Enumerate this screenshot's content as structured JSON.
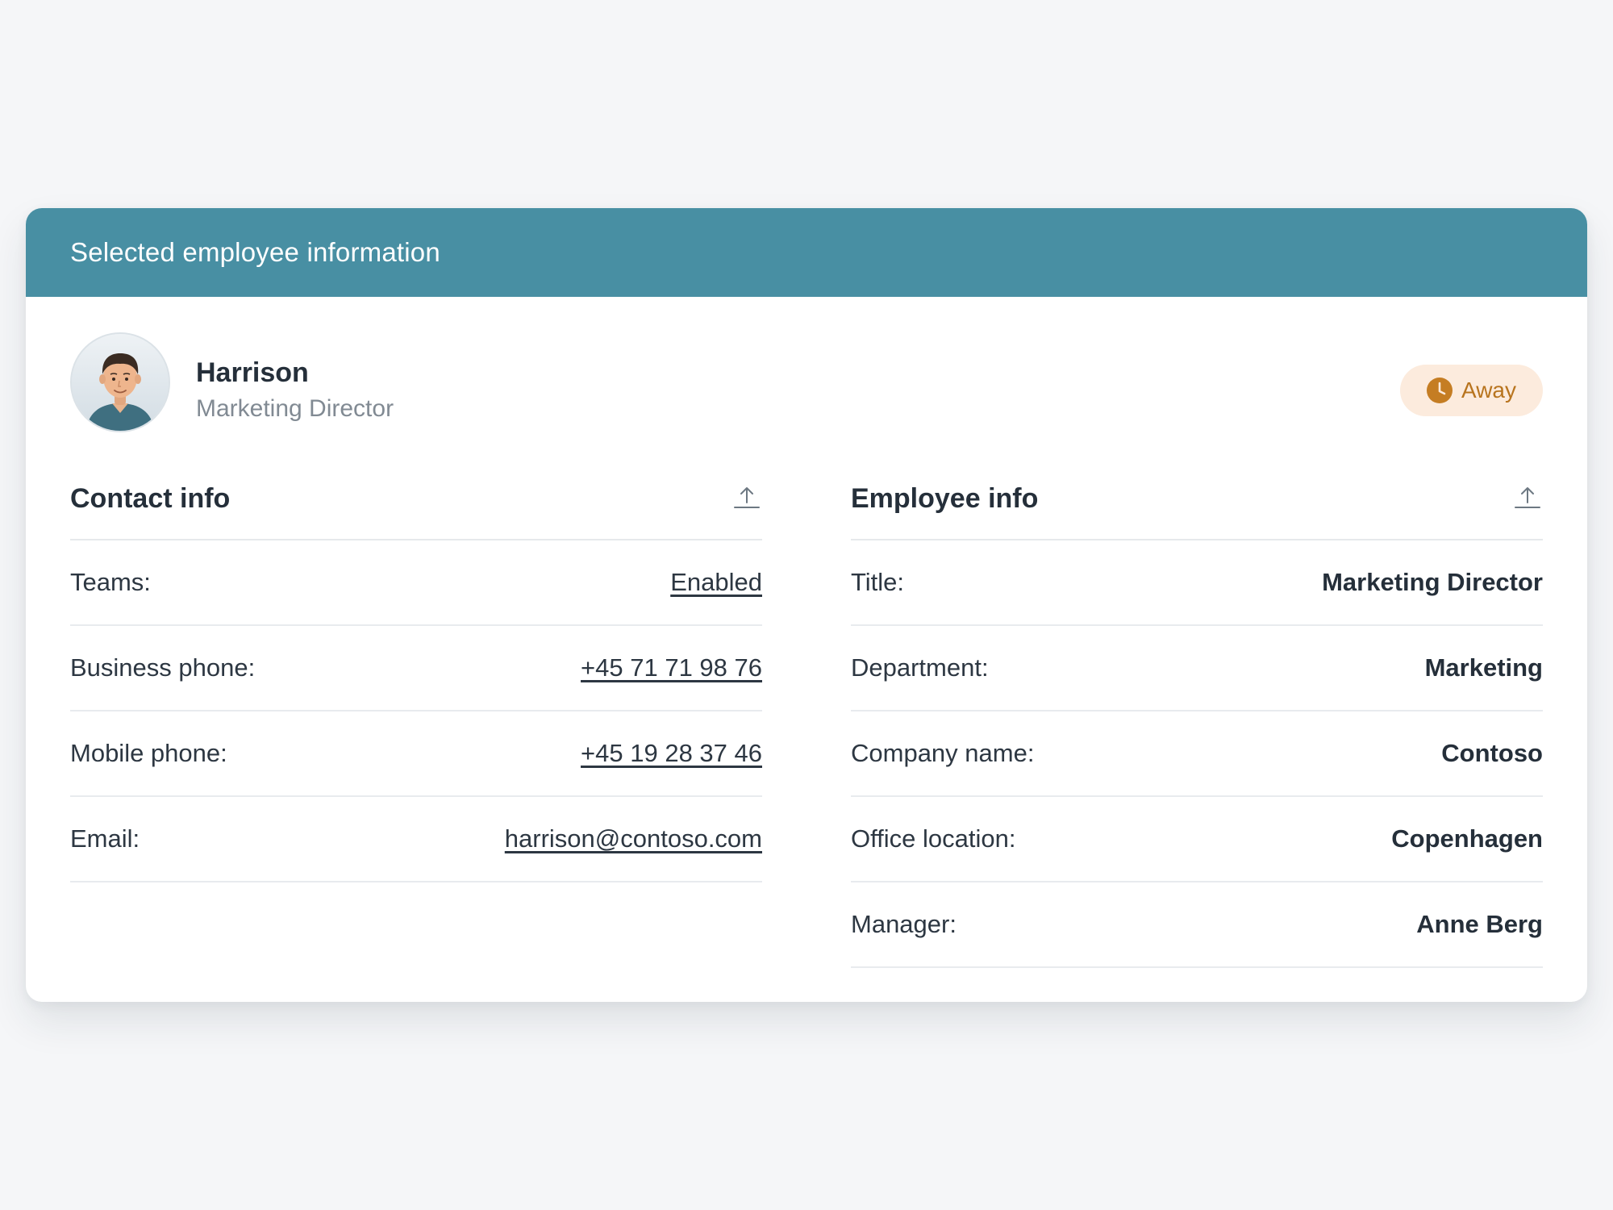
{
  "card": {
    "title": "Selected employee information"
  },
  "profile": {
    "name": "Harrison",
    "job_title": "Marketing Director",
    "avatar_icon": "person-avatar",
    "status": {
      "label": "Away",
      "icon": "clock-icon",
      "color": "#b8741e",
      "background": "#fcebdd"
    }
  },
  "contact_info": {
    "title": "Contact info",
    "export_icon": "export-upload-icon",
    "rows": [
      {
        "label": "Teams:",
        "value": "Enabled"
      },
      {
        "label": "Business phone:",
        "value": "+45 71 71 98 76"
      },
      {
        "label": "Mobile phone:",
        "value": "+45 19 28 37 46"
      },
      {
        "label": "Email:",
        "value": "harrison@contoso.com"
      }
    ]
  },
  "employee_info": {
    "title": "Employee info",
    "export_icon": "export-upload-icon",
    "rows": [
      {
        "label": "Title:",
        "value": "Marketing Director"
      },
      {
        "label": "Department:",
        "value": "Marketing"
      },
      {
        "label": "Company name:",
        "value": "Contoso"
      },
      {
        "label": "Office location:",
        "value": "Copenhagen"
      },
      {
        "label": "Manager:",
        "value": "Anne Berg"
      }
    ]
  },
  "colors": {
    "header_bg": "#488fa3",
    "page_bg": "#f5f6f8",
    "text_primary": "#252f3a",
    "text_secondary": "#818a93"
  }
}
